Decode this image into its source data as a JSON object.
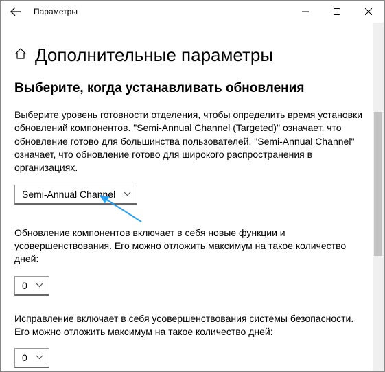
{
  "titlebar": {
    "title": "Параметры"
  },
  "page": {
    "title": "Дополнительные параметры"
  },
  "section": {
    "heading": "Выберите, когда устанавливать обновления",
    "intro": "Выберите уровень готовности отделения, чтобы определить время установки обновлений компонентов. \"Semi-Annual Channel (Targeted)\" означает, что обновление готово для большинства пользователей, \"Semi-Annual Channel\" означает, что обновление готово для широкого распространения в организациях.",
    "channel_dropdown": {
      "value": "Semi-Annual Channel"
    },
    "feature_update_text": "Обновление компонентов включает в себя новые функции и усовершенствования. Его можно отложить максимум на такое количество дней:",
    "feature_update_days": "0",
    "quality_update_text": "Исправление включает в себя усовершенствования системы безопасности. Его можно отложить максимум на такое количество дней:",
    "quality_update_days": "0"
  }
}
